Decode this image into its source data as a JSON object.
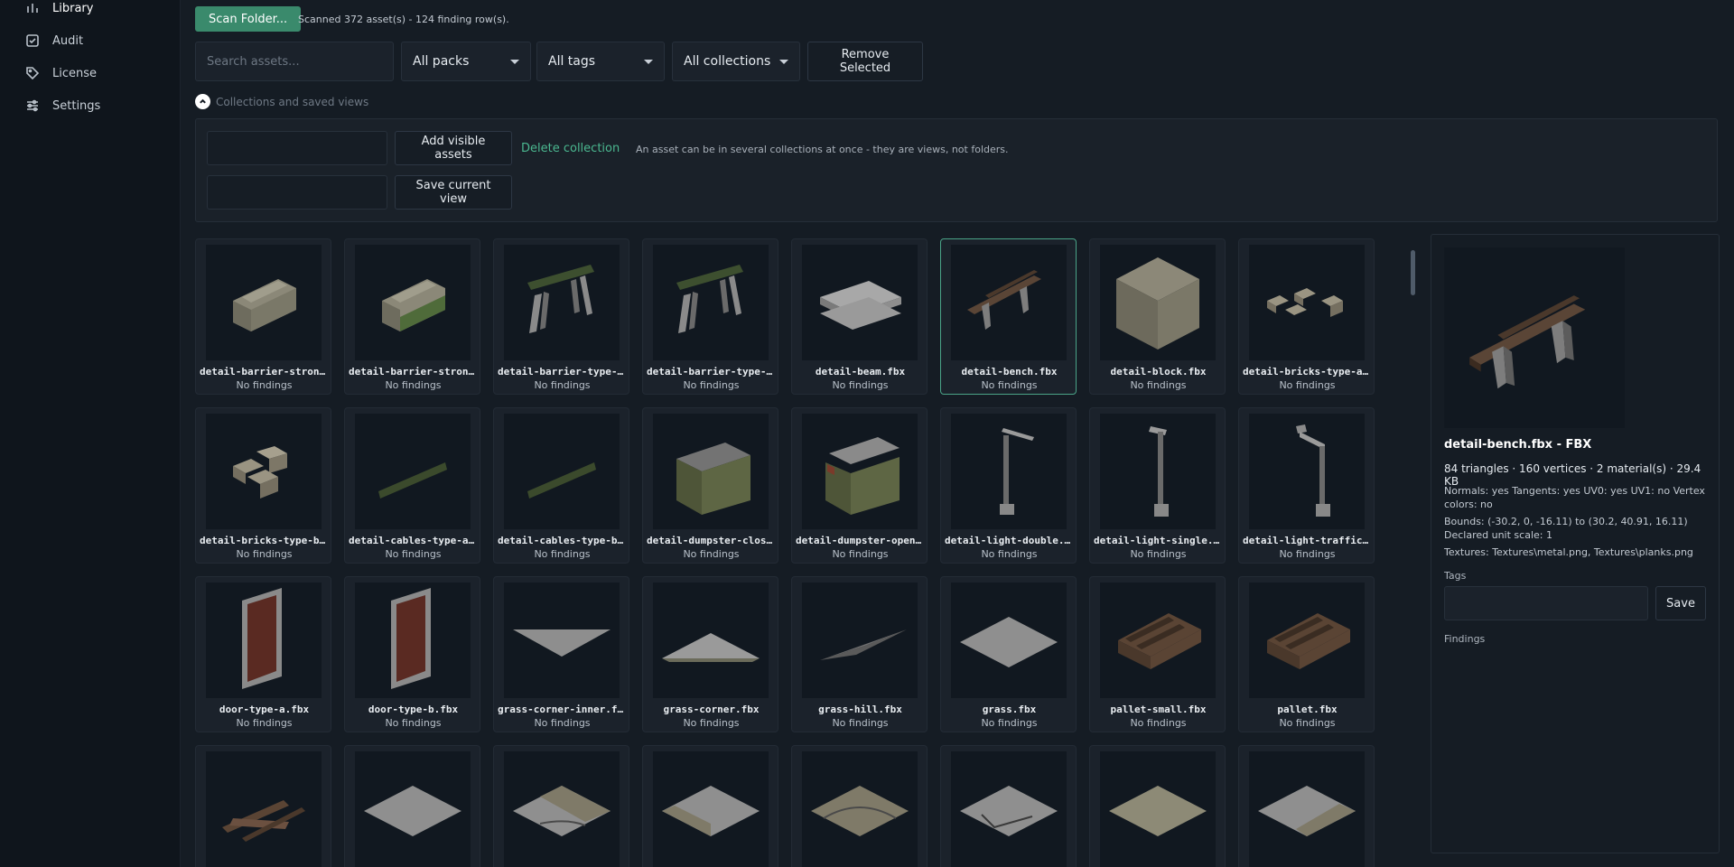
{
  "sidebar": {
    "items": [
      {
        "label": "Library",
        "icon": "bar-chart-icon"
      },
      {
        "label": "Audit",
        "icon": "checkbox-icon"
      },
      {
        "label": "License",
        "icon": "tag-icon"
      },
      {
        "label": "Settings",
        "icon": "sliders-icon"
      }
    ]
  },
  "toolbar": {
    "scan_label": "Scan Folder...",
    "status": "Scanned 372 asset(s) - 124 finding row(s)."
  },
  "filters": {
    "search_placeholder": "Search assets...",
    "packs": "All packs",
    "tags": "All tags",
    "collections": "All collections",
    "remove_label": "Remove Selected"
  },
  "collections_panel": {
    "toggle_label": "Collections and saved views",
    "add_label": "Add visible assets",
    "delete_label": "Delete collection",
    "hint": "An asset can be in several collections at once - they are views, not folders.",
    "save_view_label": "Save current view"
  },
  "assets": [
    {
      "name": "detail-barrier-strong-type-a.fbx",
      "status": "No findings",
      "shape": "barrier"
    },
    {
      "name": "detail-barrier-strong-type-b.fbx",
      "status": "No findings",
      "shape": "barrier-green"
    },
    {
      "name": "detail-barrier-type-a.fbx",
      "status": "No findings",
      "shape": "sawhorse"
    },
    {
      "name": "detail-barrier-type-b.fbx",
      "status": "No findings",
      "shape": "sawhorse"
    },
    {
      "name": "detail-beam.fbx",
      "status": "No findings",
      "shape": "beam"
    },
    {
      "name": "detail-bench.fbx",
      "status": "No findings",
      "shape": "bench"
    },
    {
      "name": "detail-block.fbx",
      "status": "No findings",
      "shape": "block"
    },
    {
      "name": "detail-bricks-type-a.fbx",
      "status": "No findings",
      "shape": "bricks-a"
    },
    {
      "name": "detail-bricks-type-b.fbx",
      "status": "No findings",
      "shape": "bricks-b"
    },
    {
      "name": "detail-cables-type-a.fbx",
      "status": "No findings",
      "shape": "cables"
    },
    {
      "name": "detail-cables-type-b.fbx",
      "status": "No findings",
      "shape": "cables"
    },
    {
      "name": "detail-dumpster-closed.fbx",
      "status": "No findings",
      "shape": "dumpster"
    },
    {
      "name": "detail-dumpster-open.fbx",
      "status": "No findings",
      "shape": "dumpster-open"
    },
    {
      "name": "detail-light-double.fbx",
      "status": "No findings",
      "shape": "light-double"
    },
    {
      "name": "detail-light-single.fbx",
      "status": "No findings",
      "shape": "light-single"
    },
    {
      "name": "detail-light-traffic.fbx",
      "status": "No findings",
      "shape": "light-traffic"
    },
    {
      "name": "door-type-a.fbx",
      "status": "No findings",
      "shape": "door"
    },
    {
      "name": "door-type-b.fbx",
      "status": "No findings",
      "shape": "door"
    },
    {
      "name": "grass-corner-inner.fbx",
      "status": "No findings",
      "shape": "tri-inner"
    },
    {
      "name": "grass-corner.fbx",
      "status": "No findings",
      "shape": "tri-corner"
    },
    {
      "name": "grass-hill.fbx",
      "status": "No findings",
      "shape": "hill"
    },
    {
      "name": "grass.fbx",
      "status": "No findings",
      "shape": "tile"
    },
    {
      "name": "pallet-small.fbx",
      "status": "No findings",
      "shape": "pallet"
    },
    {
      "name": "pallet.fbx",
      "status": "No findings",
      "shape": "pallet"
    },
    {
      "name": "",
      "status": "",
      "shape": "planks"
    },
    {
      "name": "",
      "status": "",
      "shape": "tile"
    },
    {
      "name": "",
      "status": "",
      "shape": "tile-road-a"
    },
    {
      "name": "",
      "status": "",
      "shape": "tile-road-b"
    },
    {
      "name": "",
      "status": "",
      "shape": "tile-road-c"
    },
    {
      "name": "",
      "status": "",
      "shape": "tile-crack"
    },
    {
      "name": "",
      "status": "",
      "shape": "tile-sand"
    },
    {
      "name": "",
      "status": "",
      "shape": "tile-road-d"
    }
  ],
  "selected_index": 5,
  "details": {
    "title": "detail-bench.fbx - FBX",
    "stats": "84 triangles · 160 vertices · 2 material(s) · 29.4 KB",
    "flags": "Normals: yes   Tangents: yes   UV0: yes   UV1: no   Vertex colors: no",
    "bounds": "Bounds: (-30.2, 0, -16.11) to (30.2, 40.91, 16.11)   Declared unit scale: 1",
    "textures": "Textures: Textures\\metal.png, Textures\\planks.png",
    "tags_label": "Tags",
    "save_label": "Save",
    "findings_label": "Findings"
  },
  "colors": {
    "accent": "#3a8a6c",
    "link": "#4bb890",
    "selected_border": "#4aa387"
  }
}
